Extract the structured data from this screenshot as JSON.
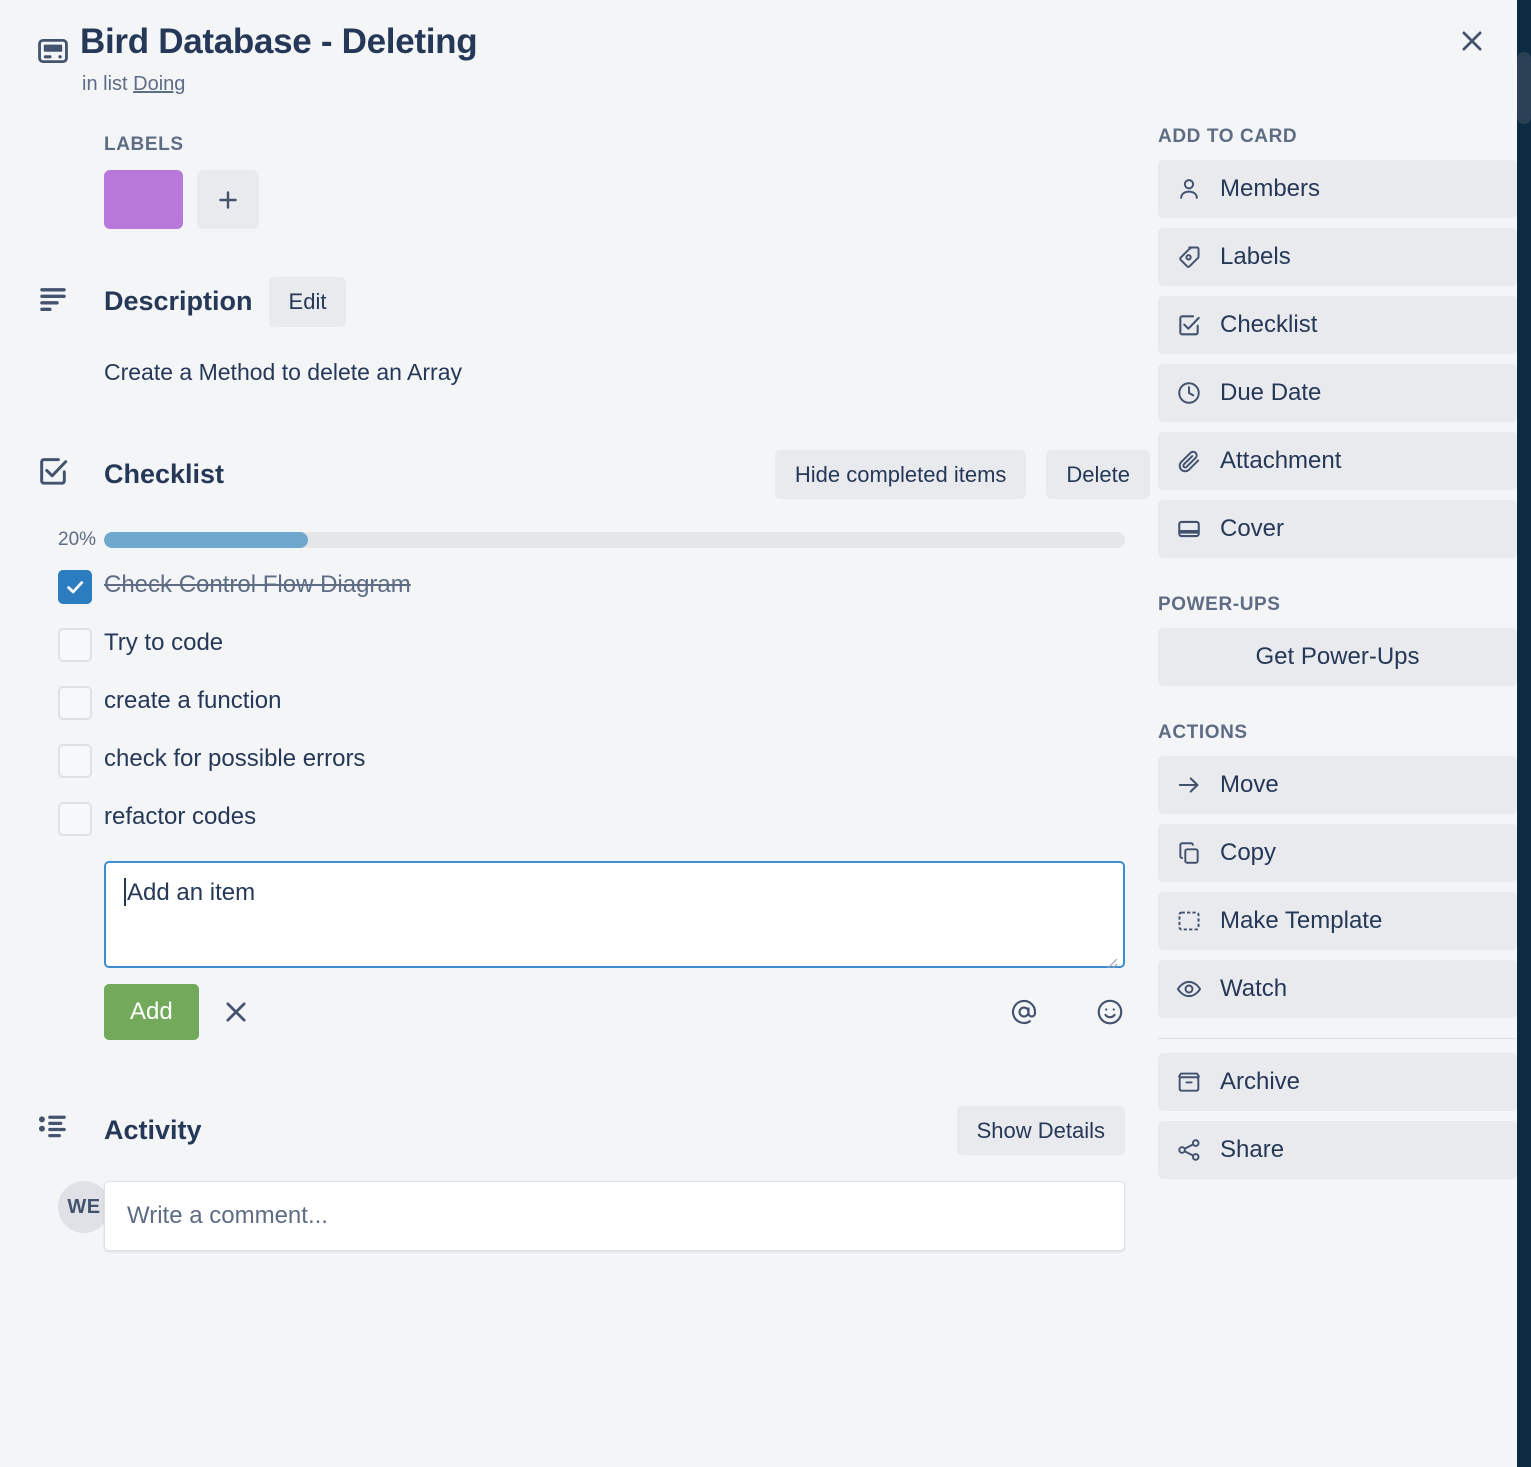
{
  "window": {
    "close_label": "×"
  },
  "card": {
    "icon": "card-icon",
    "title": "Bird Database - Deleting",
    "in_list_prefix": "in list",
    "list_name": "Doing"
  },
  "labels": {
    "heading": "LABELS",
    "swatch_color": "#b778d9",
    "add_label": "+"
  },
  "description": {
    "heading": "Description",
    "edit_label": "Edit",
    "body": "Create a Method to delete an Array"
  },
  "checklist": {
    "heading": "Checklist",
    "hide_completed_label": "Hide completed items",
    "delete_label": "Delete",
    "progress_percent_label": "20%",
    "progress_percent": 20,
    "items": [
      {
        "text": "Check Control Flow Diagram",
        "checked": true
      },
      {
        "text": "Try to code",
        "checked": false
      },
      {
        "text": "create a function",
        "checked": false
      },
      {
        "text": "check for possible errors",
        "checked": false
      },
      {
        "text": "refactor codes",
        "checked": false
      }
    ],
    "add_item_value": "Add an item",
    "add_button_label": "Add",
    "cancel_label": "×",
    "mention_icon": "at-icon",
    "emoji_icon": "emoji-icon"
  },
  "activity": {
    "heading": "Activity",
    "show_details_label": "Show Details",
    "avatar_initials": "WE",
    "comment_placeholder": "Write a comment..."
  },
  "sidebar": {
    "add_to_card": {
      "heading": "ADD TO CARD",
      "items": [
        {
          "label": "Members",
          "icon": "person-icon"
        },
        {
          "label": "Labels",
          "icon": "tag-icon"
        },
        {
          "label": "Checklist",
          "icon": "checkbox-icon"
        },
        {
          "label": "Due Date",
          "icon": "clock-icon"
        },
        {
          "label": "Attachment",
          "icon": "paperclip-icon"
        },
        {
          "label": "Cover",
          "icon": "cover-icon"
        }
      ]
    },
    "power_ups": {
      "heading": "POWER-UPS",
      "button_label": "Get Power-Ups"
    },
    "actions": {
      "heading": "ACTIONS",
      "items": [
        {
          "label": "Move",
          "icon": "arrow-right-icon"
        },
        {
          "label": "Copy",
          "icon": "copy-icon"
        },
        {
          "label": "Make Template",
          "icon": "template-icon"
        },
        {
          "label": "Watch",
          "icon": "eye-icon"
        }
      ],
      "secondary_items": [
        {
          "label": "Archive",
          "icon": "archive-icon"
        },
        {
          "label": "Share",
          "icon": "share-icon"
        }
      ]
    }
  }
}
